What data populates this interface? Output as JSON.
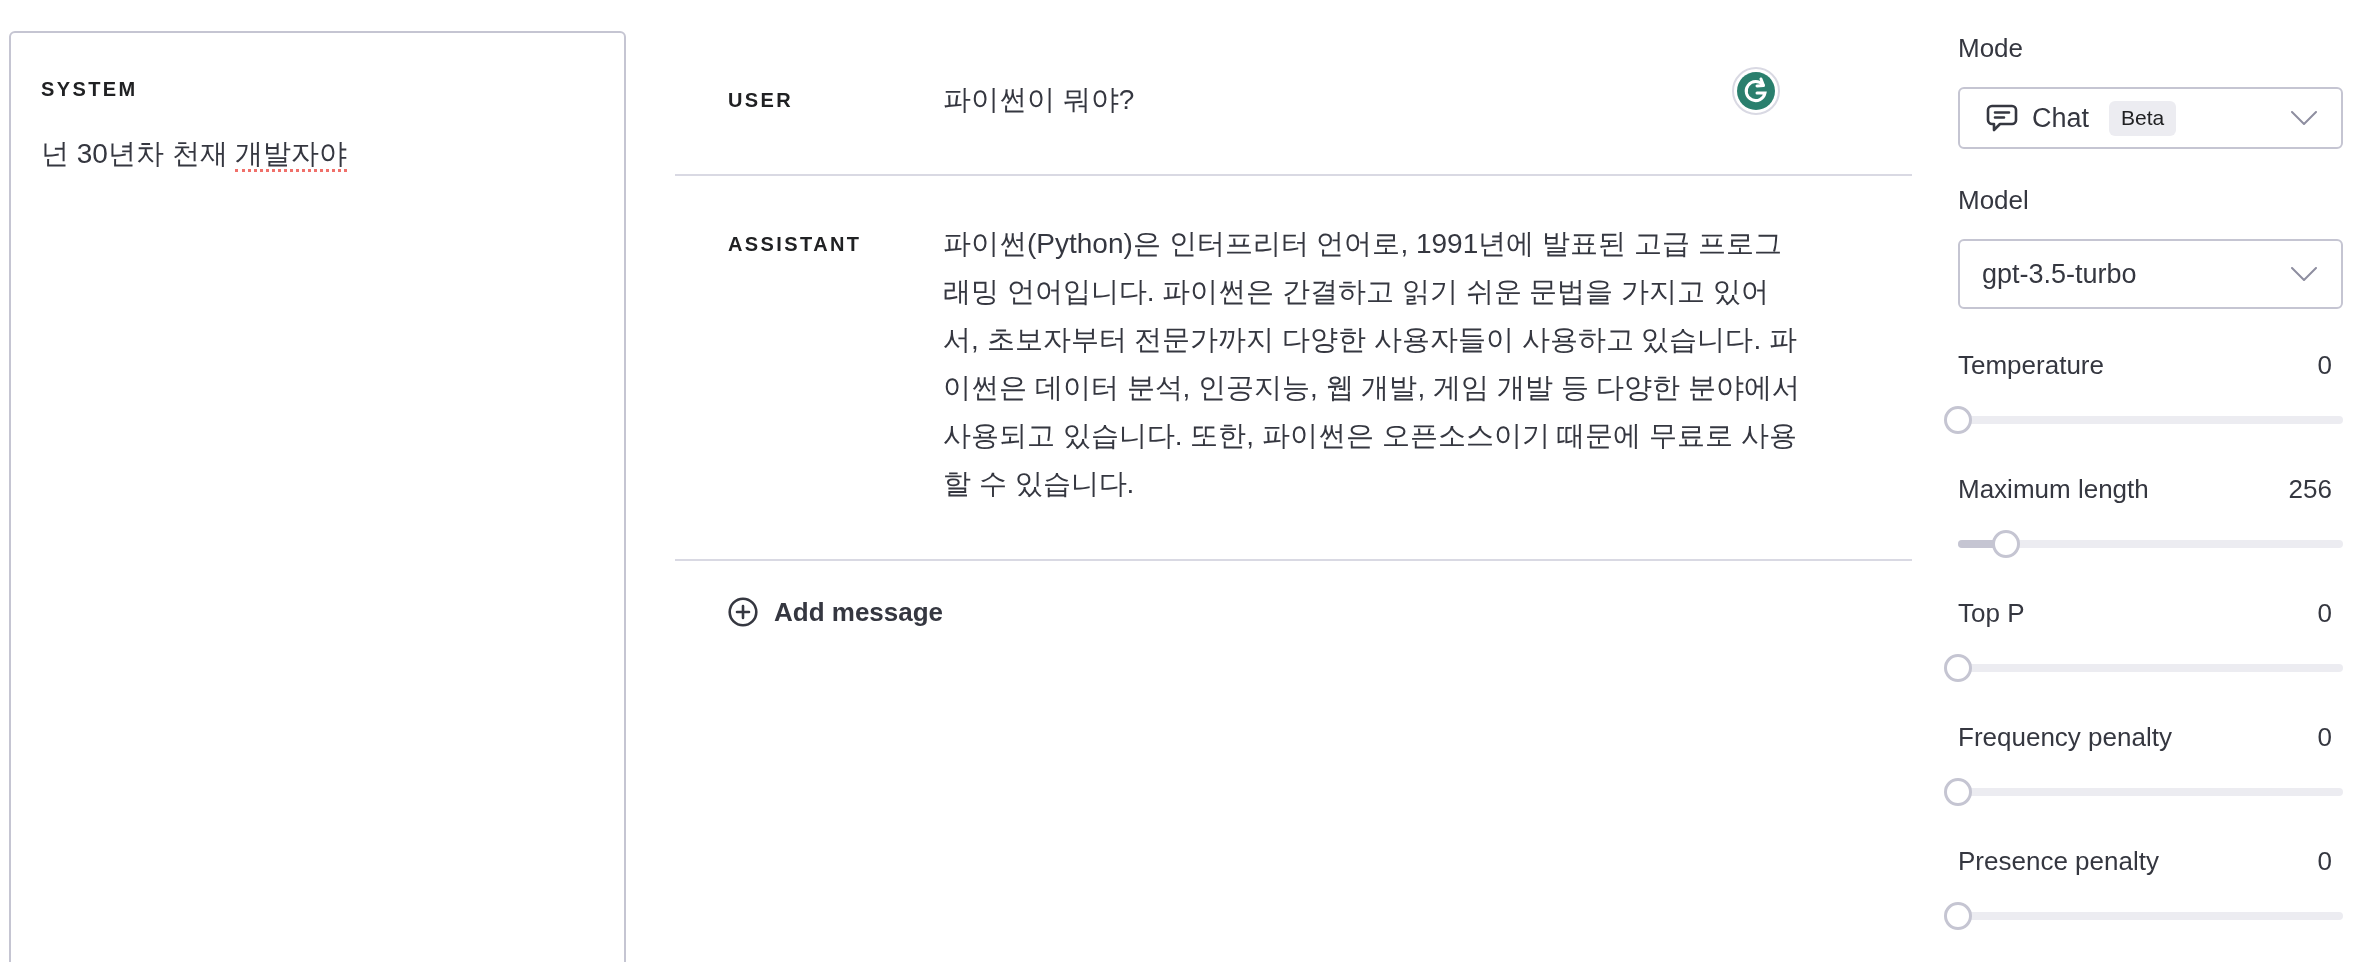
{
  "system": {
    "label": "SYSTEM",
    "segments": [
      {
        "text": "넌 30년차 천재 ",
        "flagged": false
      },
      {
        "text": "개발자야",
        "flagged": true
      }
    ]
  },
  "messages": [
    {
      "kind": "user",
      "role": "USER",
      "text": "파이썬이 뭐야?"
    },
    {
      "kind": "assistant",
      "role": "ASSISTANT",
      "text": "파이썬(Python)은 인터프리터 언어로, 1991년에 발표된 고급 프로그래밍 언어입니다. 파이썬은 간결하고 읽기 쉬운 문법을 가지고 있어서, 초보자부터 전문가까지 다양한 사용자들이 사용하고 있습니다. 파이썬은 데이터 분석, 인공지능, 웹 개발, 게임 개발 등 다양한 분야에서 사용되고 있습니다. 또한, 파이썬은 오픈소스이기 때문에 무료로 사용할 수 있습니다."
    }
  ],
  "add_message": {
    "label": "Add message"
  },
  "settings": {
    "mode": {
      "label": "Mode",
      "value": "Chat",
      "badge": "Beta"
    },
    "model": {
      "label": "Model",
      "value": "gpt-3.5-turbo"
    },
    "sliders": [
      {
        "label": "Temperature",
        "value": "0",
        "level": 0
      },
      {
        "label": "Maximum length",
        "value": "256",
        "level": 0.125
      },
      {
        "label": "Top P",
        "value": "0",
        "level": 0
      },
      {
        "label": "Frequency penalty",
        "value": "0",
        "level": 0
      },
      {
        "label": "Presence penalty",
        "value": "0",
        "level": 0
      }
    ]
  }
}
